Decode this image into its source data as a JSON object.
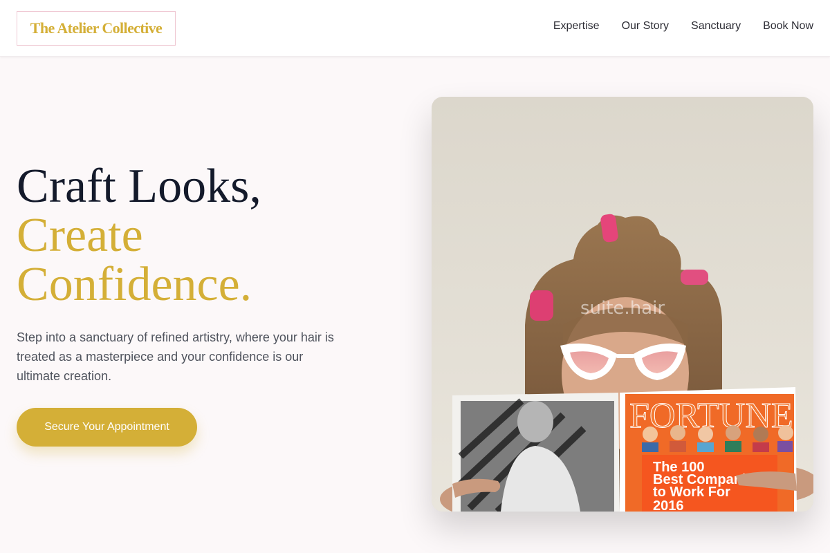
{
  "header": {
    "logo_text": "The Atelier Collective",
    "nav": [
      {
        "label": "Expertise"
      },
      {
        "label": "Our Story"
      },
      {
        "label": "Sanctuary"
      },
      {
        "label": "Book Now"
      }
    ]
  },
  "hero": {
    "title_line1": "Craft Looks,",
    "title_line2": "Create",
    "title_line3": "Confidence.",
    "description": "Step into a sanctuary of refined artistry, where your hair is treated as a masterpiece and your confidence is our ultimate creation.",
    "cta_label": "Secure Your Appointment"
  },
  "image": {
    "watermark": "suite.hair",
    "magazine_title": "FORTUNE",
    "magazine_line1": "The 100",
    "magazine_line2": "Best Companies",
    "magazine_line3": "to Work For",
    "magazine_line4": "2016"
  },
  "colors": {
    "accent": "#d4af37",
    "heading": "#141a2b",
    "body_text": "#4f535d",
    "background": "#fcf8f9",
    "logo_border": "#efc7d2"
  }
}
